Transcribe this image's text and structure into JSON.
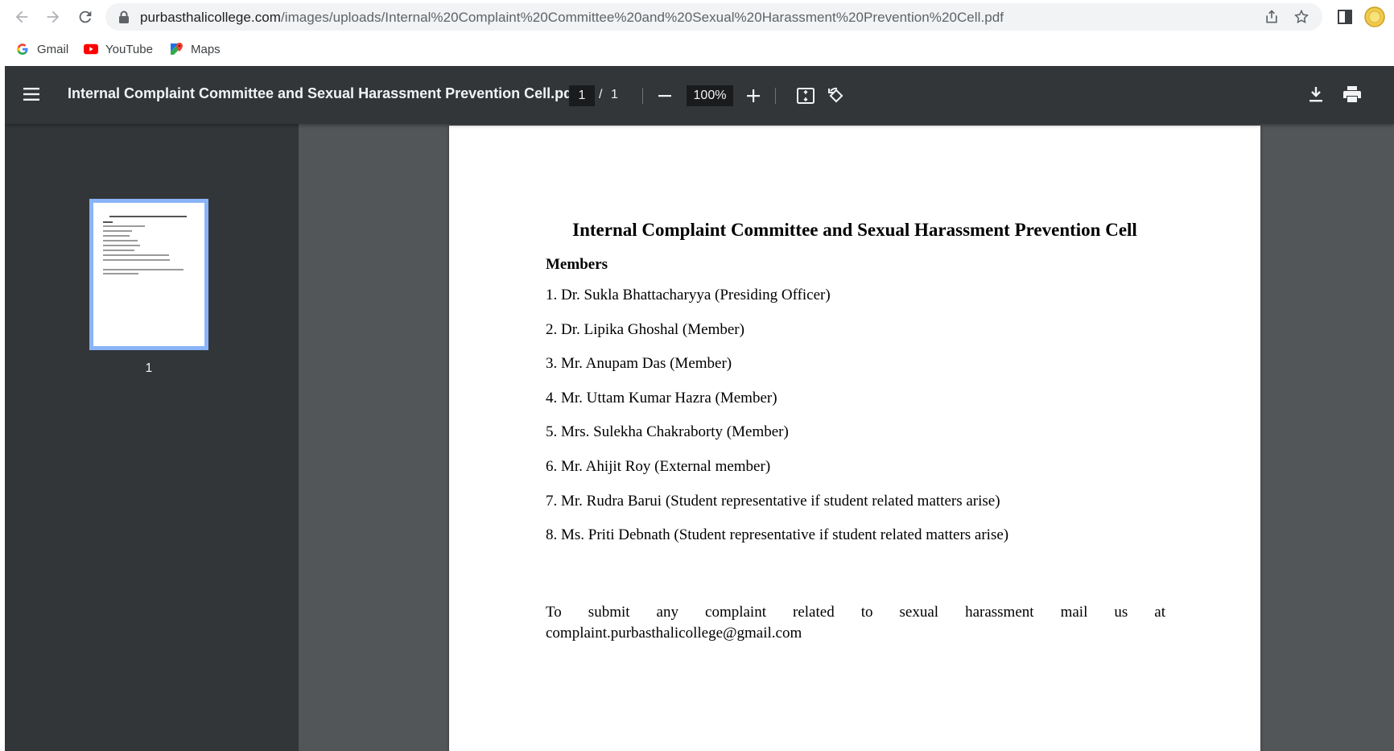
{
  "browser": {
    "url_host": "purbasthalicollege.com",
    "url_path": "/images/uploads/Internal%20Complaint%20Committee%20and%20Sexual%20Harassment%20Prevention%20Cell.pdf",
    "bookmarks": [
      {
        "label": "Gmail",
        "icon": "google-icon"
      },
      {
        "label": "YouTube",
        "icon": "youtube-icon"
      },
      {
        "label": "Maps",
        "icon": "maps-icon"
      }
    ]
  },
  "viewer": {
    "file_name": "Internal Complaint Committee and Sexual Harassment Prevention Cell.pdf",
    "current_page": "1",
    "page_separator": "/",
    "total_pages": "1",
    "zoom": "100%",
    "thumbnail_label": "1"
  },
  "document": {
    "title": "Internal Complaint Committee and Sexual Harassment Prevention Cell",
    "members_heading": "Members",
    "members": [
      "1. Dr. Sukla Bhattacharyya (Presiding Officer)",
      "2. Dr. Lipika Ghoshal (Member)",
      "3. Mr. Anupam Das (Member)",
      "4. Mr. Uttam Kumar Hazra (Member)",
      "5. Mrs. Sulekha Chakraborty (Member)",
      "6. Mr. Ahijit Roy (External member)",
      "7. Mr. Rudra Barui (Student representative if student related matters arise)",
      "8. Ms. Priti Debnath (Student representative if student related matters arise)"
    ],
    "complaint_text": "To submit any complaint related to sexual harassment mail us at complaint.purbasthalicollege@gmail.com"
  },
  "colors": {
    "toolbar": "#323639",
    "viewer_background": "#525659",
    "thumbnail_highlight": "#8ab4f8"
  }
}
